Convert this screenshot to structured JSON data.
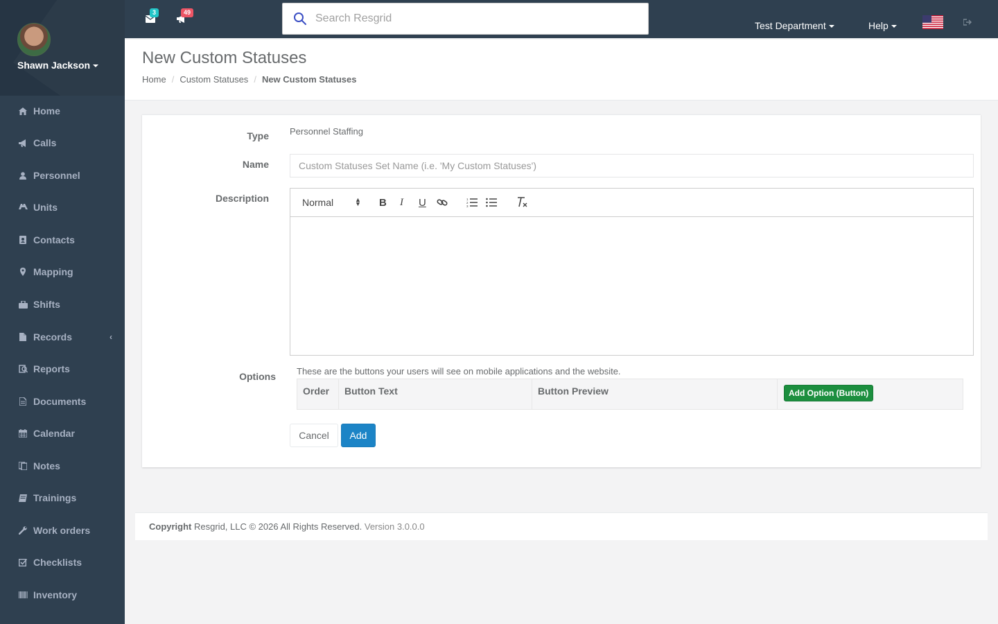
{
  "user": {
    "name": "Shawn Jackson"
  },
  "sidebar": {
    "items": [
      {
        "label": "Home",
        "icon": "home-icon"
      },
      {
        "label": "Calls",
        "icon": "bullhorn-icon"
      },
      {
        "label": "Personnel",
        "icon": "user-icon"
      },
      {
        "label": "Units",
        "icon": "truck-icon"
      },
      {
        "label": "Contacts",
        "icon": "address-book-icon"
      },
      {
        "label": "Mapping",
        "icon": "map-marker-icon"
      },
      {
        "label": "Shifts",
        "icon": "briefcase-icon"
      },
      {
        "label": "Records",
        "icon": "file-icon"
      },
      {
        "label": "Reports",
        "icon": "report-icon"
      },
      {
        "label": "Documents",
        "icon": "document-icon"
      },
      {
        "label": "Calendar",
        "icon": "calendar-icon"
      },
      {
        "label": "Notes",
        "icon": "notes-icon"
      },
      {
        "label": "Trainings",
        "icon": "book-icon"
      },
      {
        "label": "Work orders",
        "icon": "wrench-icon"
      },
      {
        "label": "Checklists",
        "icon": "checklist-icon"
      },
      {
        "label": "Inventory",
        "icon": "barcode-icon"
      }
    ]
  },
  "topbar": {
    "messages_count": "3",
    "calls_count": "49",
    "search_placeholder": "Search Resgrid",
    "department": "Test Department",
    "help": "Help"
  },
  "header": {
    "title": "New Custom Statuses",
    "breadcrumb": [
      "Home",
      "Custom Statuses",
      "New Custom Statuses"
    ]
  },
  "form": {
    "type_label": "Type",
    "type_value": "Personnel Staffing",
    "name_label": "Name",
    "name_placeholder": "Custom Statuses Set Name (i.e. 'My Custom Statuses')",
    "description_label": "Description",
    "editor_format": "Normal",
    "options_label": "Options",
    "options_help": "These are the buttons your users will see on mobile applications and the website.",
    "columns": [
      "Order",
      "Button Text",
      "Button Preview"
    ],
    "add_option_label": "Add Option (Button)",
    "cancel_label": "Cancel",
    "add_label": "Add"
  },
  "footer": {
    "copyright_bold": "Copyright",
    "copyright_text": " Resgrid, LLC © 2026 All Rights Reserved. ",
    "version": "Version 3.0.0.0"
  },
  "colors": {
    "sidebar": "#2f4050",
    "primary": "#1c84c6",
    "success": "#1c8f3f",
    "badge_info": "#23c6c8",
    "badge_danger": "#ed5565"
  }
}
